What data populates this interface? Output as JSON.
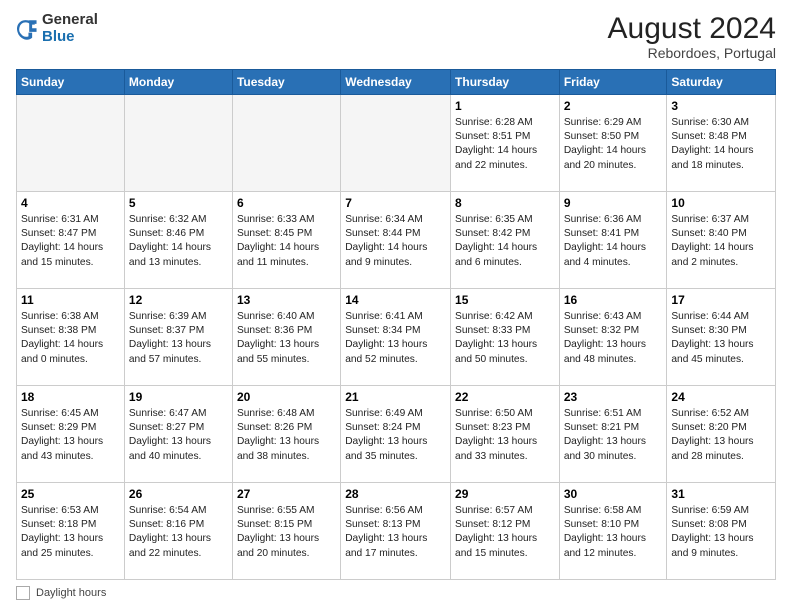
{
  "header": {
    "logo_general": "General",
    "logo_blue": "Blue",
    "month_year": "August 2024",
    "location": "Rebordoes, Portugal"
  },
  "days_of_week": [
    "Sunday",
    "Monday",
    "Tuesday",
    "Wednesday",
    "Thursday",
    "Friday",
    "Saturday"
  ],
  "weeks": [
    [
      {
        "day": "",
        "empty": true
      },
      {
        "day": "",
        "empty": true
      },
      {
        "day": "",
        "empty": true
      },
      {
        "day": "",
        "empty": true
      },
      {
        "day": "1",
        "sunrise": "6:28 AM",
        "sunset": "8:51 PM",
        "daylight": "14 hours and 22 minutes."
      },
      {
        "day": "2",
        "sunrise": "6:29 AM",
        "sunset": "8:50 PM",
        "daylight": "14 hours and 20 minutes."
      },
      {
        "day": "3",
        "sunrise": "6:30 AM",
        "sunset": "8:48 PM",
        "daylight": "14 hours and 18 minutes."
      }
    ],
    [
      {
        "day": "4",
        "sunrise": "6:31 AM",
        "sunset": "8:47 PM",
        "daylight": "14 hours and 15 minutes."
      },
      {
        "day": "5",
        "sunrise": "6:32 AM",
        "sunset": "8:46 PM",
        "daylight": "14 hours and 13 minutes."
      },
      {
        "day": "6",
        "sunrise": "6:33 AM",
        "sunset": "8:45 PM",
        "daylight": "14 hours and 11 minutes."
      },
      {
        "day": "7",
        "sunrise": "6:34 AM",
        "sunset": "8:44 PM",
        "daylight": "14 hours and 9 minutes."
      },
      {
        "day": "8",
        "sunrise": "6:35 AM",
        "sunset": "8:42 PM",
        "daylight": "14 hours and 6 minutes."
      },
      {
        "day": "9",
        "sunrise": "6:36 AM",
        "sunset": "8:41 PM",
        "daylight": "14 hours and 4 minutes."
      },
      {
        "day": "10",
        "sunrise": "6:37 AM",
        "sunset": "8:40 PM",
        "daylight": "14 hours and 2 minutes."
      }
    ],
    [
      {
        "day": "11",
        "sunrise": "6:38 AM",
        "sunset": "8:38 PM",
        "daylight": "14 hours and 0 minutes."
      },
      {
        "day": "12",
        "sunrise": "6:39 AM",
        "sunset": "8:37 PM",
        "daylight": "13 hours and 57 minutes."
      },
      {
        "day": "13",
        "sunrise": "6:40 AM",
        "sunset": "8:36 PM",
        "daylight": "13 hours and 55 minutes."
      },
      {
        "day": "14",
        "sunrise": "6:41 AM",
        "sunset": "8:34 PM",
        "daylight": "13 hours and 52 minutes."
      },
      {
        "day": "15",
        "sunrise": "6:42 AM",
        "sunset": "8:33 PM",
        "daylight": "13 hours and 50 minutes."
      },
      {
        "day": "16",
        "sunrise": "6:43 AM",
        "sunset": "8:32 PM",
        "daylight": "13 hours and 48 minutes."
      },
      {
        "day": "17",
        "sunrise": "6:44 AM",
        "sunset": "8:30 PM",
        "daylight": "13 hours and 45 minutes."
      }
    ],
    [
      {
        "day": "18",
        "sunrise": "6:45 AM",
        "sunset": "8:29 PM",
        "daylight": "13 hours and 43 minutes."
      },
      {
        "day": "19",
        "sunrise": "6:47 AM",
        "sunset": "8:27 PM",
        "daylight": "13 hours and 40 minutes."
      },
      {
        "day": "20",
        "sunrise": "6:48 AM",
        "sunset": "8:26 PM",
        "daylight": "13 hours and 38 minutes."
      },
      {
        "day": "21",
        "sunrise": "6:49 AM",
        "sunset": "8:24 PM",
        "daylight": "13 hours and 35 minutes."
      },
      {
        "day": "22",
        "sunrise": "6:50 AM",
        "sunset": "8:23 PM",
        "daylight": "13 hours and 33 minutes."
      },
      {
        "day": "23",
        "sunrise": "6:51 AM",
        "sunset": "8:21 PM",
        "daylight": "13 hours and 30 minutes."
      },
      {
        "day": "24",
        "sunrise": "6:52 AM",
        "sunset": "8:20 PM",
        "daylight": "13 hours and 28 minutes."
      }
    ],
    [
      {
        "day": "25",
        "sunrise": "6:53 AM",
        "sunset": "8:18 PM",
        "daylight": "13 hours and 25 minutes."
      },
      {
        "day": "26",
        "sunrise": "6:54 AM",
        "sunset": "8:16 PM",
        "daylight": "13 hours and 22 minutes."
      },
      {
        "day": "27",
        "sunrise": "6:55 AM",
        "sunset": "8:15 PM",
        "daylight": "13 hours and 20 minutes."
      },
      {
        "day": "28",
        "sunrise": "6:56 AM",
        "sunset": "8:13 PM",
        "daylight": "13 hours and 17 minutes."
      },
      {
        "day": "29",
        "sunrise": "6:57 AM",
        "sunset": "8:12 PM",
        "daylight": "13 hours and 15 minutes."
      },
      {
        "day": "30",
        "sunrise": "6:58 AM",
        "sunset": "8:10 PM",
        "daylight": "13 hours and 12 minutes."
      },
      {
        "day": "31",
        "sunrise": "6:59 AM",
        "sunset": "8:08 PM",
        "daylight": "13 hours and 9 minutes."
      }
    ]
  ],
  "footer": {
    "label": "Daylight hours"
  }
}
